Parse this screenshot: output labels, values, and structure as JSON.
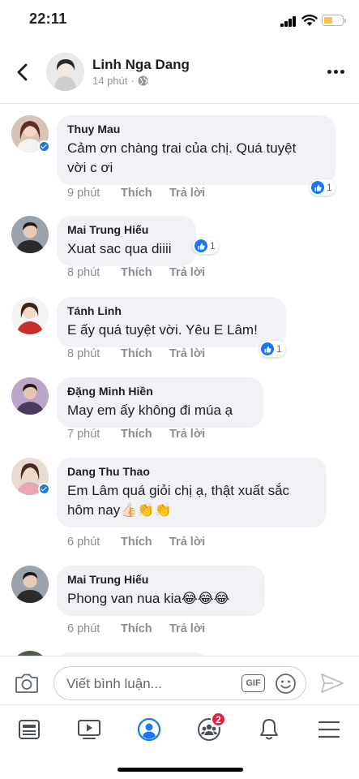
{
  "status_bar": {
    "time": "22:11"
  },
  "post": {
    "author": "Linh Nga Dang",
    "time": "14 phút",
    "separator": "·"
  },
  "comments": [
    {
      "name": "Thuy Mau",
      "lines": [
        "Cảm ơn chàng trai của chị. Quá tuyệt",
        "vời c ơi"
      ],
      "time": "9 phút",
      "like": "Thích",
      "reply": "Trả lời",
      "reactions": "1",
      "verified": true
    },
    {
      "name": "Mai Trung Hiếu",
      "lines": [
        "Xuat sac qua diiii"
      ],
      "time": "8 phút",
      "like": "Thích",
      "reply": "Trả lời",
      "reactions": "1",
      "verified": false
    },
    {
      "name": "Tánh Linh",
      "lines": [
        "E ấy quá tuyệt vời. Yêu E Lâm!"
      ],
      "time": "8 phút",
      "like": "Thích",
      "reply": "Trả lời",
      "reactions": "1",
      "verified": false
    },
    {
      "name": "Đặng Minh Hiền",
      "lines": [
        "May em ấy không đi múa ạ"
      ],
      "time": "7 phút",
      "like": "Thích",
      "reply": "Trả lời",
      "reactions": "",
      "verified": false
    },
    {
      "name": "Dang Thu Thao",
      "lines": [
        "Em Lâm quá giỏi chị ạ, thật xuất sắc",
        "hôm nay👍🏻👏👏"
      ],
      "time": "6 phút",
      "like": "Thích",
      "reply": "Trả lời",
      "reactions": "",
      "verified": true
    },
    {
      "name": "Mai Trung Hiếu",
      "lines": [
        "Phong van nua kia😂😂😂"
      ],
      "time": "6 phút",
      "like": "Thích",
      "reply": "Trả lời",
      "reactions": "",
      "verified": false
    }
  ],
  "composer": {
    "placeholder": "Viết bình luận...",
    "gif_label": "GIF"
  },
  "tabs": {
    "groups_badge": "2"
  },
  "icons": [
    "back-icon",
    "globe-icon",
    "more-icon",
    "like-icon",
    "camera-icon",
    "gif-icon",
    "emoji-icon",
    "send-icon",
    "news-feed-icon",
    "watch-icon",
    "profile-icon",
    "groups-icon",
    "bell-icon",
    "menu-icon"
  ],
  "colors": {
    "accent": "#1877f2",
    "bubble": "#f0f2f5",
    "badge": "#e41e3f",
    "battery": "#f6c444"
  }
}
